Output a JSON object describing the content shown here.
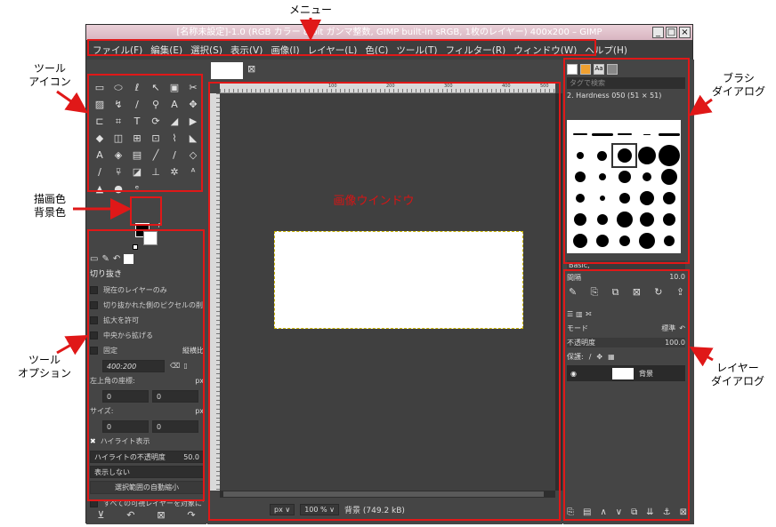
{
  "annotations": {
    "menu": "メニュー",
    "tool_icons": "ツール\nアイコン",
    "fg_bg": "描画色\n背景色",
    "tool_options": "ツール\nオプション",
    "image_window": "画像ウインドウ",
    "brush_dialog": "ブラシ\nダイアログ",
    "layer_dialog": "レイヤー\nダイアログ"
  },
  "window": {
    "title": "[名称未設定]-1.0 (RGB カラー 8 bit ガンマ整数, GIMP built-in sRGB, 1枚のレイヤー) 400x200 – GIMP",
    "buttons": [
      "_",
      "□",
      "×"
    ]
  },
  "menu": [
    "ファイル(F)",
    "編集(E)",
    "選択(S)",
    "表示(V)",
    "画像(I)",
    "レイヤー(L)",
    "色(C)",
    "ツール(T)",
    "フィルター(R)",
    "ウィンドウ(W)",
    "ヘルプ(H)"
  ],
  "toolbox": {
    "tools": [
      {
        "name": "rect-select",
        "glyph": "▭"
      },
      {
        "name": "ellipse-select",
        "glyph": "⬭"
      },
      {
        "name": "free-select",
        "glyph": "ℓ"
      },
      {
        "name": "fuzzy-select",
        "glyph": "↖"
      },
      {
        "name": "by-color-select",
        "glyph": "▣"
      },
      {
        "name": "scissors",
        "glyph": "✂"
      },
      {
        "name": "foreground-select",
        "glyph": "▨"
      },
      {
        "name": "paths",
        "glyph": "↯"
      },
      {
        "name": "color-picker",
        "glyph": "/"
      },
      {
        "name": "zoom",
        "glyph": "⚲"
      },
      {
        "name": "measure",
        "glyph": "A"
      },
      {
        "name": "move",
        "glyph": "✥"
      },
      {
        "name": "align",
        "glyph": "⊏"
      },
      {
        "name": "crop",
        "glyph": "⌗"
      },
      {
        "name": "unified-transform",
        "glyph": "T"
      },
      {
        "name": "rotate",
        "glyph": "⟳"
      },
      {
        "name": "scale",
        "glyph": "◢"
      },
      {
        "name": "shear",
        "glyph": "▶"
      },
      {
        "name": "perspective",
        "glyph": "◆"
      },
      {
        "name": "3d-transform",
        "glyph": "◫"
      },
      {
        "name": "flip",
        "glyph": "⊞"
      },
      {
        "name": "cage",
        "glyph": "⊡"
      },
      {
        "name": "warp",
        "glyph": "⌇"
      },
      {
        "name": "smudge-blend",
        "glyph": "◣"
      },
      {
        "name": "text",
        "glyph": "A"
      },
      {
        "name": "bucket-fill",
        "glyph": "◈"
      },
      {
        "name": "gradient",
        "glyph": "▤"
      },
      {
        "name": "pencil",
        "glyph": "╱"
      },
      {
        "name": "paintbrush",
        "glyph": "/"
      },
      {
        "name": "eraser",
        "glyph": "◇"
      },
      {
        "name": "airbrush",
        "glyph": "∕"
      },
      {
        "name": "ink",
        "glyph": "⍫"
      },
      {
        "name": "mypaint",
        "glyph": "◪"
      },
      {
        "name": "clone",
        "glyph": "⊥"
      },
      {
        "name": "heal",
        "glyph": "✲"
      },
      {
        "name": "perspective-clone",
        "glyph": "ᴬ"
      },
      {
        "name": "blur",
        "glyph": "▲"
      },
      {
        "name": "dodge-burn",
        "glyph": "●"
      },
      {
        "name": "smudge",
        "glyph": "ᵉ"
      }
    ]
  },
  "tool_options": {
    "title": "切り抜き",
    "current_layer_only": "現在のレイヤーのみ",
    "delete_cropped": "切り抜かれた側のピクセルの削除",
    "allow_growing": "拡大を許可",
    "expand_from_center": "中央から拡げる",
    "fixed": "固定",
    "fixed_mode": "縦横比",
    "ratio": "400:200",
    "position_label": "左上角の座標:",
    "position_unit": "px",
    "pos_x": "0",
    "pos_y": "0",
    "size_label": "サイズ:",
    "size_unit": "px",
    "size_x": "0",
    "size_y": "0",
    "highlight": "ハイライト表示",
    "highlight_opacity_label": "ハイライトの不透明度",
    "highlight_opacity_value": "50.0",
    "guides": "表示しない",
    "auto_shrink": "選択範囲の自動縮小",
    "shrink_merged": "すべての可視レイヤーを対象にする"
  },
  "canvas": {
    "status_unit": "px",
    "zoom": "100 %",
    "status_text": "背景 (749.2 kB)",
    "ruler_labels": [
      "100",
      "200",
      "300",
      "400",
      "500"
    ]
  },
  "brushes": {
    "filter_placeholder": "タグで検索",
    "current_brush": "2. Hardness 050 (51 × 51)",
    "tag": "Basic,",
    "spacing_label": "間隔",
    "spacing_value": "10.0"
  },
  "layers": {
    "mode_label": "モード",
    "mode_value": "標準",
    "opacity_label": "不透明度",
    "opacity_value": "100.0",
    "lock_label": "保護:",
    "layer_name": "背景"
  },
  "colors": {
    "annotation_red": "#e01818",
    "window_bg": "#454545"
  }
}
